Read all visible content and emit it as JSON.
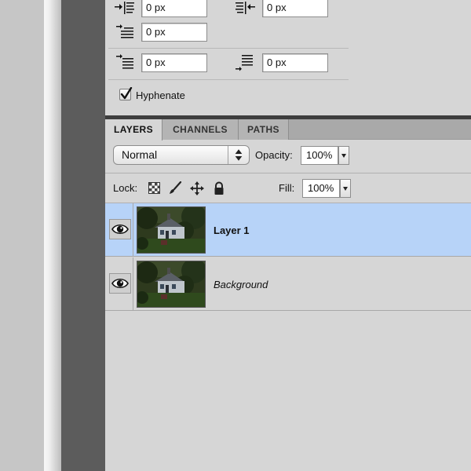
{
  "paragraph": {
    "indent_left": "0 px",
    "indent_right": "0 px",
    "indent_first_line": "0 px",
    "space_before": "0 px",
    "space_after": "0 px",
    "hyphenate_label": "Hyphenate",
    "hyphenate_checked": true
  },
  "panel_tabs": [
    {
      "label": "LAYERS",
      "active": true
    },
    {
      "label": "CHANNELS",
      "active": false
    },
    {
      "label": "PATHS",
      "active": false
    }
  ],
  "layers_controls": {
    "blend_mode": "Normal",
    "opacity_label": "Opacity:",
    "opacity_value": "100%",
    "lock_label": "Lock:",
    "fill_label": "Fill:",
    "fill_value": "100%"
  },
  "layers": [
    {
      "name": "Layer 1",
      "selected": true,
      "visible": true
    },
    {
      "name": "Background",
      "selected": false,
      "visible": true
    }
  ],
  "colors": {
    "selection": "#b7d3f8",
    "panel_bg": "#d6d6d6",
    "panel_bar": "#3e3e3e"
  }
}
